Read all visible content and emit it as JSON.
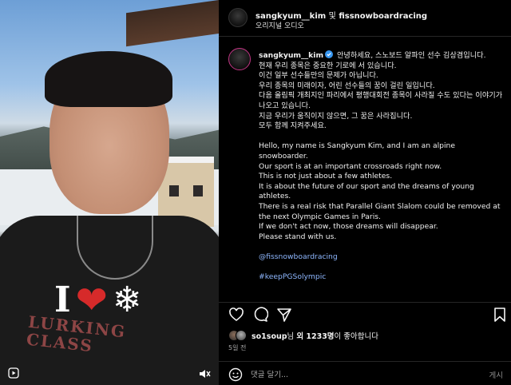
{
  "media": {
    "overlay_letter": "I",
    "shirt_print": [
      "LURKING",
      "CLASS"
    ],
    "icons": [
      "heart-icon",
      "snowflake-icon",
      "reel-icon",
      "mute-icon"
    ]
  },
  "header": {
    "username": "sangkyum__kim",
    "joiner": "및",
    "collaborator": "fissnowboardracing",
    "audio": "오리지널 오디오"
  },
  "caption": {
    "username": "sangkyum__kim",
    "verified": true,
    "korean_first": "안녕하세요, 스노보드 알파인 선수 김상겸입니다.",
    "korean": [
      "현재 우리 종목은 중요한 기로에 서 있습니다.",
      "이건 일부 선수들만의 문제가 아닙니다.",
      "우리 종목의 미래이자, 어린 선수들의 꿈이 걸린 일입니다.",
      "다음 올림픽 개최지인 파리에서 평행대회전 종목이 사라질 수도 있다는 이야기가 나오고 있습니다.",
      "지금 우리가 움직이지 않으면, 그 꿈은 사라집니다.",
      "모두 함께 지켜주세요."
    ],
    "english": [
      "Hello, my name is Sangkyum Kim, and I am an alpine snowboarder.",
      "Our sport is at an important crossroads right now.",
      "This is not just about a few athletes.",
      "It is about the future of our sport and the dreams of young athletes.",
      "There is a real risk that Parallel Giant Slalom could be removed at the next Olympic Games in Paris.",
      "If we don't act now, those dreams will disappear.",
      "Please stand with us."
    ],
    "mention": "@fissnowboardracing",
    "hashtag": "#keepPGSolympic"
  },
  "actions": {
    "icons": [
      "heart-icon",
      "comment-icon",
      "share-icon",
      "bookmark-icon"
    ]
  },
  "likes": {
    "user": "so1soup",
    "suffix_pre": "님 ",
    "count_text": "외 1233명",
    "suffix_post": "이 좋아합니다"
  },
  "time": "5일 전",
  "comment": {
    "placeholder": "댓글 달기...",
    "post_label": "게시"
  },
  "colors": {
    "background": "#000000",
    "link": "#8fb8ff",
    "heart": "#d62a2a",
    "muted": "#a8a8a8"
  }
}
